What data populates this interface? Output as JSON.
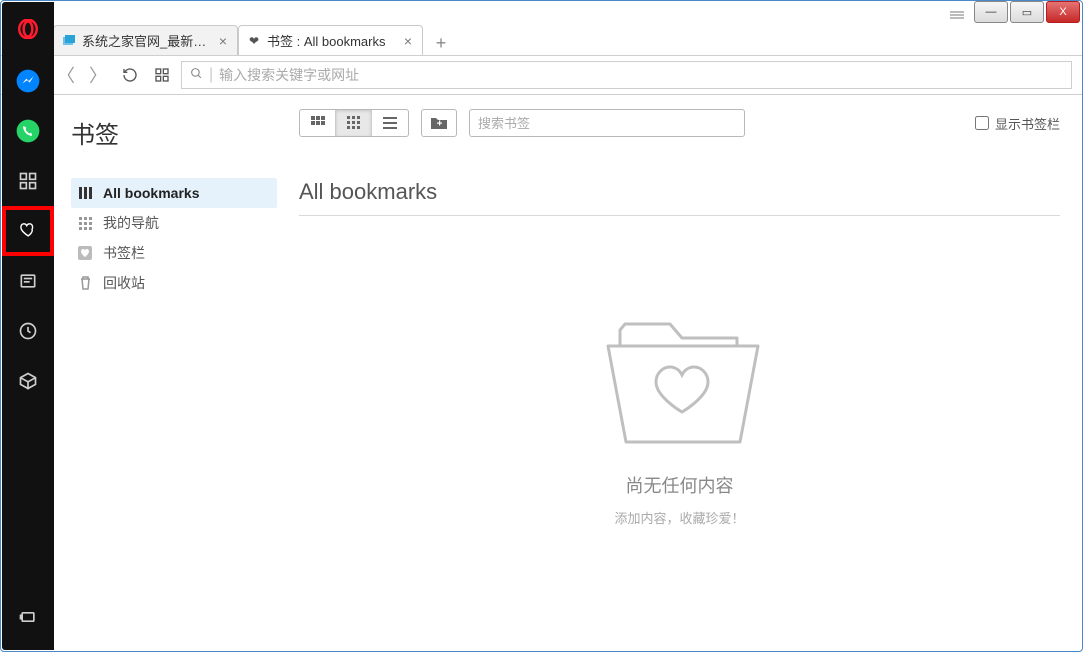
{
  "window": {
    "minimize_glyph": "—",
    "maximize_glyph": "▭",
    "close_glyph": "X"
  },
  "tabs": [
    {
      "title": "系统之家官网_最新Ghost",
      "favicon_color": "#2aa3d8",
      "active": false
    },
    {
      "title": "书签 : All bookmarks",
      "favicon_heart": true,
      "active": true
    }
  ],
  "newtab_glyph": "+",
  "toolbar": {
    "address_placeholder": "输入搜索关键字或网址"
  },
  "sidebar": {
    "items": [
      {
        "name": "opera-logo"
      },
      {
        "name": "messenger-icon"
      },
      {
        "name": "whatsapp-icon"
      },
      {
        "name": "speed-dial-icon"
      },
      {
        "name": "bookmarks-heart-icon",
        "highlighted": true
      },
      {
        "name": "personal-news-icon"
      },
      {
        "name": "history-icon"
      },
      {
        "name": "extensions-icon"
      }
    ],
    "bottom_item": {
      "name": "sidebar-settings-icon"
    }
  },
  "bookmarks": {
    "page_title": "书签",
    "nav": [
      {
        "icon": "bars",
        "label": "All bookmarks",
        "active": true
      },
      {
        "icon": "grid",
        "label": "我的导航"
      },
      {
        "icon": "heart-box",
        "label": "书签栏"
      },
      {
        "icon": "trash",
        "label": "回收站"
      }
    ],
    "search_placeholder": "搜索书签",
    "show_bar_label": "显示书签栏",
    "content_heading": "All bookmarks",
    "empty_title": "尚无任何内容",
    "empty_subtitle": "添加内容，收藏珍爱！"
  }
}
